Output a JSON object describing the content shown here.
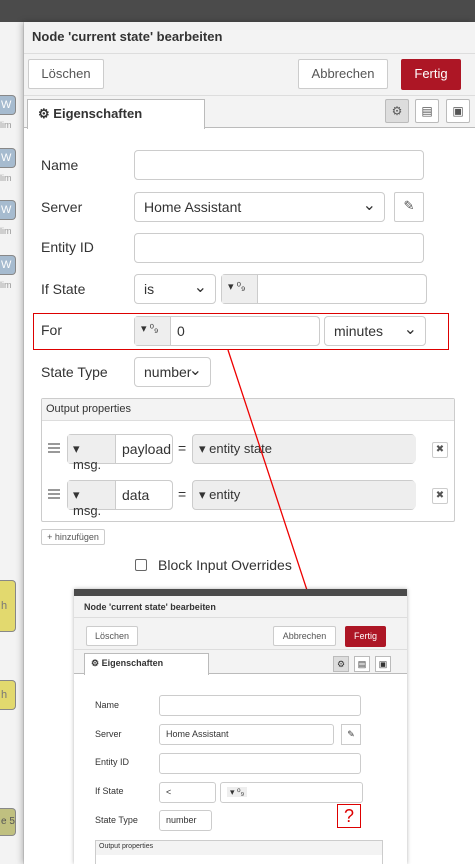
{
  "dialog": {
    "title": "Node 'current state' bearbeiten",
    "buttons": {
      "delete": "Löschen",
      "cancel": "Abbrechen",
      "done": "Fertig"
    },
    "tab_label": "Eigenschaften"
  },
  "form": {
    "name_label": "Name",
    "name_value": "",
    "server_label": "Server",
    "server_value": "Home Assistant",
    "entity_label": "Entity ID",
    "entity_value": "",
    "ifstate_label": "If State",
    "ifstate_operator": "is",
    "ifstate_type_icon": "⁰₉",
    "ifstate_value": "",
    "for_label": "For",
    "for_type_icon": "⁰₉",
    "for_value": "0",
    "for_unit": "minutes",
    "statetype_label": "State Type",
    "statetype_value": "number"
  },
  "output": {
    "heading": "Output properties",
    "rows": [
      {
        "prefix": "msg.",
        "property": "payload",
        "value": "entity state"
      },
      {
        "prefix": "msg.",
        "property": "data",
        "value": "entity"
      }
    ],
    "add_label": "hinzufügen"
  },
  "block_input": {
    "label": "Block Input Overrides",
    "checked": false
  },
  "workspace": {
    "node_letters": [
      "W",
      "W",
      "W",
      "W"
    ],
    "sub_labels": [
      "lim",
      "lim",
      "lim",
      "lim"
    ],
    "h_labels": [
      "h",
      "h"
    ],
    "bottom_label": "e 5"
  },
  "inset": {
    "title": "Node 'current state' bearbeiten",
    "delete": "Löschen",
    "cancel": "Abbrechen",
    "done": "Fertig",
    "tab": "Eigenschaften",
    "name_label": "Name",
    "server_label": "Server",
    "server_value": "Home Assistant",
    "entity_label": "Entity ID",
    "ifstate_label": "If State",
    "ifstate_operator": "<",
    "ifstate_type_icon": "⁰₉",
    "statetype_label": "State Type",
    "statetype_value": "number",
    "output_heading": "Output properties"
  },
  "annotation": {
    "question_mark": "?"
  },
  "colors": {
    "primary": "#ad1625",
    "highlight": "#d00000"
  }
}
